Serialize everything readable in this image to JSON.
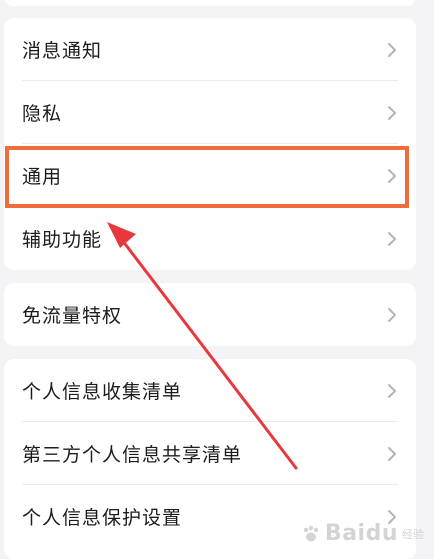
{
  "groups": [
    {
      "items": [
        {
          "label": "消息通知"
        },
        {
          "label": "隐私"
        },
        {
          "label": "通用"
        },
        {
          "label": "辅助功能"
        }
      ]
    },
    {
      "items": [
        {
          "label": "免流量特权"
        }
      ]
    },
    {
      "items": [
        {
          "label": "个人信息收集清单"
        },
        {
          "label": "第三方个人信息共享清单"
        },
        {
          "label": "个人信息保护设置"
        }
      ]
    }
  ],
  "annotation": {
    "highlight_color": "#ef6d3b",
    "arrow_color": "#e8383d"
  },
  "watermark": {
    "text": "Baidu",
    "sub": "经验"
  }
}
